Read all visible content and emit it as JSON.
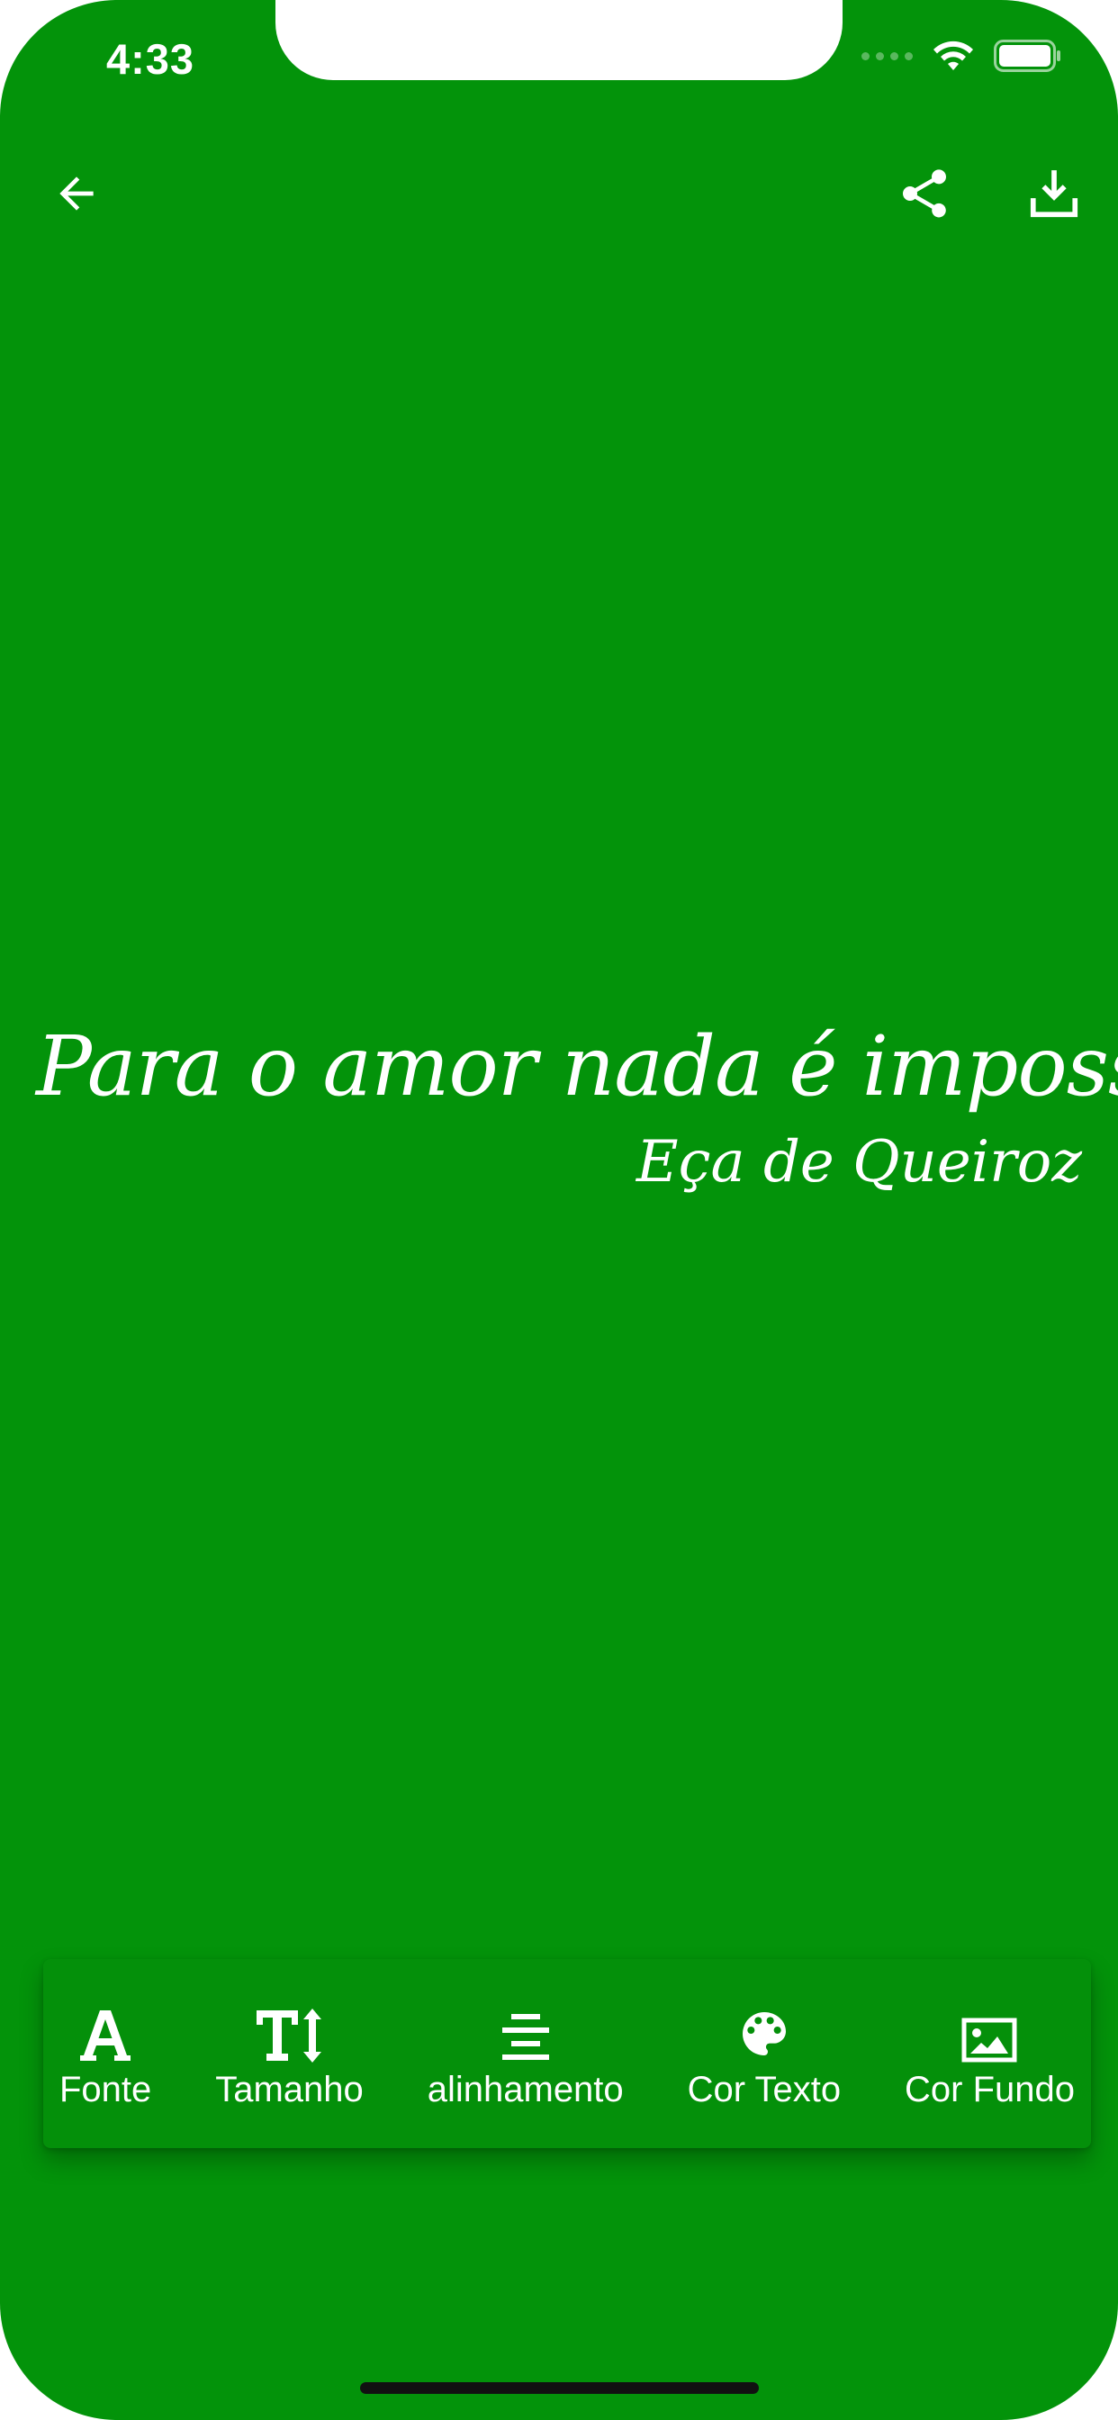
{
  "status_bar": {
    "time": "4:33"
  },
  "header": {
    "back_icon": "arrow-left-icon",
    "share_icon": "share-icon",
    "download_icon": "download-icon"
  },
  "quote": {
    "text": "Para o amor nada é impossível.",
    "author": "Eça de Queiroz"
  },
  "toolbar": {
    "items": [
      {
        "label": "Fonte",
        "icon": "font-icon"
      },
      {
        "label": "Tamanho",
        "icon": "text-size-icon"
      },
      {
        "label": "alinhamento",
        "icon": "align-center-icon"
      },
      {
        "label": "Cor Texto",
        "icon": "palette-icon"
      },
      {
        "label": "Cor Fundo",
        "icon": "image-icon"
      }
    ]
  },
  "colors": {
    "background": "#03930a",
    "toolbar": "#04900a",
    "text": "#ffffff"
  }
}
